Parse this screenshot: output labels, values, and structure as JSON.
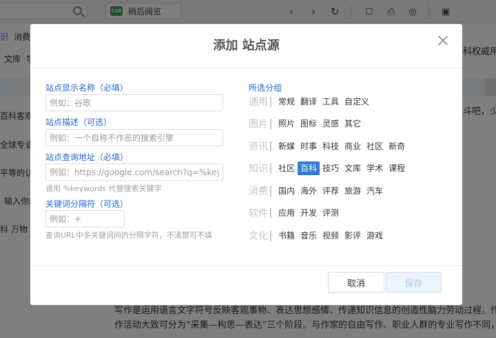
{
  "browser_toolbar": {
    "read_later_label": "稍后阅览",
    "read_later_badge": "CSE"
  },
  "background": {
    "nav_items": [
      "识",
      "消费"
    ],
    "nav_sub": [
      "文库",
      "学"
    ],
    "right_snippets": [
      "科权威用",
      "斗吧，少"
    ],
    "left_snippets": [
      "百科客观专",
      "全球专业",
      "平等的认",
      "输入你想",
      "科 万物"
    ],
    "article_lines": [
      "写作是运用语言文字符号反映客观事物、表达思想感情、传递知识信息的创造性脑力劳动过程。作为",
      "作活动大致可分为“采集—构思—表达”三个阶段。与作家的自由写作、职业人群的专业写作不同，语文"
    ]
  },
  "dialog": {
    "title": "添加 站点源",
    "name_label": "站点显示名称（必填）",
    "name_placeholder": "例如：谷歌",
    "desc_label": "站点描述（可选）",
    "desc_placeholder": "例如：一个自称不作恶的搜索引擎",
    "url_label": "站点查询地址（必填）",
    "url_placeholder": "例如：https://google.com/search?q=%keywords",
    "url_hint": "请用 %keywords 代替搜索关键字",
    "sep_label": "关键词分隔符（可选）",
    "sep_placeholder": "例如：+",
    "sep_hint": "查询URL中多关键词间的分隔字符，不清楚可不填",
    "groups_title": "所选分组",
    "groups": [
      {
        "name": "通用",
        "tags": [
          "常规",
          "翻译",
          "工具",
          "自定义"
        ]
      },
      {
        "name": "图片",
        "tags": [
          "照片",
          "图标",
          "灵感",
          "其它"
        ]
      },
      {
        "name": "资讯",
        "tags": [
          "新媒",
          "时事",
          "科技",
          "商业",
          "社区",
          "新奇"
        ]
      },
      {
        "name": "知识",
        "tags": [
          "社区",
          "百科",
          "技巧",
          "文库",
          "学术",
          "课程"
        ]
      },
      {
        "name": "消费",
        "tags": [
          "国内",
          "海外",
          "评荐",
          "旅游",
          "汽车"
        ]
      },
      {
        "name": "软件",
        "tags": [
          "应用",
          "开发",
          "评测"
        ]
      },
      {
        "name": "文化",
        "tags": [
          "书籍",
          "音乐",
          "视频",
          "影评",
          "游戏"
        ]
      }
    ],
    "selected_group": "知识",
    "selected_tag": "百科",
    "cancel_label": "取消",
    "save_label": "保存"
  }
}
